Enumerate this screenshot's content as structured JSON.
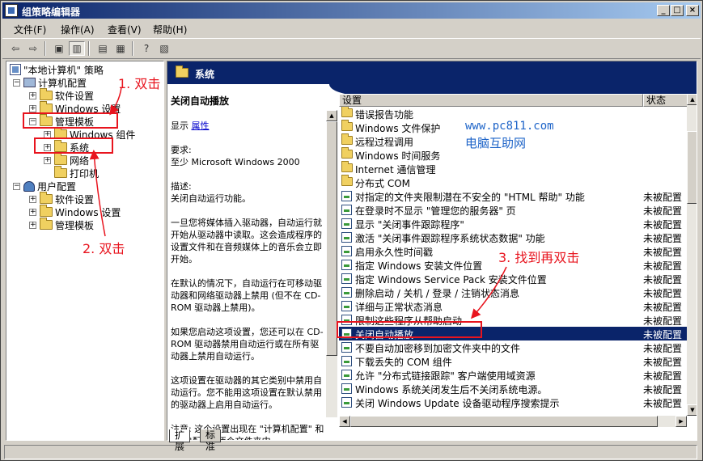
{
  "window": {
    "title": "组策略编辑器"
  },
  "menu": [
    "文件(F)",
    "操作(A)",
    "查看(V)",
    "帮助(H)"
  ],
  "tree": {
    "items": [
      {
        "label": "\"本地计算机\" 策略",
        "icon": "policy-root-icon",
        "expander": ""
      },
      {
        "label": "计算机配置",
        "icon": "computer-icon",
        "expander": "−"
      },
      {
        "label": "软件设置",
        "icon": "folder-icon",
        "expander": "+"
      },
      {
        "label": "Windows 设置",
        "icon": "folder-icon",
        "expander": "+"
      },
      {
        "label": "管理模板",
        "icon": "folder-icon",
        "expander": "−"
      },
      {
        "label": "Windows 组件",
        "icon": "folder-icon",
        "expander": "+"
      },
      {
        "label": "系统",
        "icon": "folder-icon",
        "expander": "+"
      },
      {
        "label": "网络",
        "icon": "folder-icon",
        "expander": "+"
      },
      {
        "label": "打印机",
        "icon": "folder-icon",
        "expander": ""
      },
      {
        "label": "用户配置",
        "icon": "user-icon",
        "expander": "−"
      },
      {
        "label": "软件设置",
        "icon": "folder-icon",
        "expander": "+"
      },
      {
        "label": "Windows 设置",
        "icon": "folder-icon",
        "expander": "+"
      },
      {
        "label": "管理模板",
        "icon": "folder-icon",
        "expander": "+"
      }
    ]
  },
  "panel": {
    "banner": "系统",
    "desc_title": "关闭自动播放",
    "display_label": "显示",
    "display_link": "属性",
    "requirements": "要求:\n至少 Microsoft Windows 2000",
    "description_label": "描述:",
    "description_text": "关闭自动运行功能。",
    "para1": "一旦您将媒体插入驱动器，自动运行就开始从驱动器中读取。这会造成程序的设置文件和在音频媒体上的音乐会立即开始。",
    "para2": "在默认的情况下，自动运行在可移动驱动器和网络驱动器上禁用 (但不在 CD-ROM 驱动器上禁用)。",
    "para3": "如果您启动这项设置，您还可以在 CD-ROM 驱动器禁用自动运行或在所有驱动器上禁用自动运行。",
    "para4": "这项设置在驱动器的其它类别中禁用自动运行。您不能用这项设置在默认禁用的驱动器上启用自动运行。",
    "para5": "注意: 这个设置出现在 \"计算机配置\" 和 \"用户配置\" 两个文件夹中。"
  },
  "list": {
    "col_setting": "设置",
    "col_state": "状态",
    "rows": [
      {
        "name": "错误报告功能",
        "state": "",
        "type": "folder"
      },
      {
        "name": "Windows 文件保护",
        "state": "",
        "type": "folder"
      },
      {
        "name": "远程过程调用",
        "state": "",
        "type": "folder"
      },
      {
        "name": "Windows 时间服务",
        "state": "",
        "type": "folder"
      },
      {
        "name": "Internet 通信管理",
        "state": "",
        "type": "folder"
      },
      {
        "name": "分布式 COM",
        "state": "",
        "type": "folder"
      },
      {
        "name": "对指定的文件夹限制潜在不安全的 \"HTML 帮助\" 功能",
        "state": "未被配置",
        "type": "setting"
      },
      {
        "name": "在登录时不显示 \"管理您的服务器\" 页",
        "state": "未被配置",
        "type": "setting"
      },
      {
        "name": "显示 \"关闭事件跟踪程序\"",
        "state": "未被配置",
        "type": "setting"
      },
      {
        "name": "激活 \"关闭事件跟踪程序系统状态数据\" 功能",
        "state": "未被配置",
        "type": "setting"
      },
      {
        "name": "启用永久性时间戳",
        "state": "未被配置",
        "type": "setting"
      },
      {
        "name": "指定 Windows 安装文件位置",
        "state": "未被配置",
        "type": "setting"
      },
      {
        "name": "指定 Windows Service Pack 安装文件位置",
        "state": "未被配置",
        "type": "setting"
      },
      {
        "name": "删除启动 / 关机 / 登录 / 注销状态消息",
        "state": "未被配置",
        "type": "setting"
      },
      {
        "name": "详细与正常状态消息",
        "state": "未被配置",
        "type": "setting"
      },
      {
        "name": "限制这些程序从帮助启动",
        "state": "未被配置",
        "type": "setting"
      },
      {
        "name": "关闭自动播放",
        "state": "未被配置",
        "type": "setting",
        "selected": true
      },
      {
        "name": "不要自动加密移到加密文件夹中的文件",
        "state": "未被配置",
        "type": "setting"
      },
      {
        "name": "下载丢失的 COM 组件",
        "state": "未被配置",
        "type": "setting"
      },
      {
        "name": "允许 \"分布式链接跟踪\" 客户端使用域资源",
        "state": "未被配置",
        "type": "setting"
      },
      {
        "name": "Windows 系统关闭发生后不关闭系统电源。",
        "state": "未被配置",
        "type": "setting"
      },
      {
        "name": "关闭 Windows Update 设备驱动程序搜索提示",
        "state": "未被配置",
        "type": "setting"
      }
    ]
  },
  "tabs": [
    "扩展",
    "标准"
  ],
  "annotations": {
    "step1": "1. 双击",
    "step2": "2. 双击",
    "step3": "3. 找到再双击",
    "watermark_url": "www.pc811.com",
    "watermark_name": "电脑互助网",
    "color": "#e8141e"
  }
}
